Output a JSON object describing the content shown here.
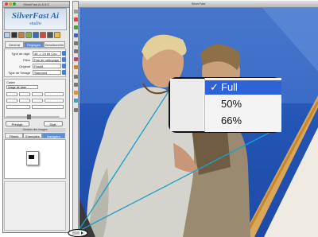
{
  "control_window": {
    "title": "SilverFast Ai 6.5.5",
    "logo": {
      "main": "SilverFast Ai",
      "sub": "studio"
    },
    "tabs": [
      {
        "label": "Général",
        "active": false
      },
      {
        "label": "Réglages",
        "active": true
      },
      {
        "label": "Densitomètre",
        "active": false
      }
    ],
    "fields": [
      {
        "label": "Type de digit.",
        "value": "48 -> 24 bit Cou"
      },
      {
        "label": "Filtre",
        "value": "Pas de nettoyage"
      },
      {
        "label": "Original",
        "value": "Positif"
      },
      {
        "label": "Type de l'image",
        "value": "Standard"
      }
    ],
    "frame_label": "Cadre",
    "frame_value": "Image de base",
    "buttons": [
      {
        "label": "Prédigit."
      },
      {
        "label": "Digit."
      }
    ],
    "section_header": "Gestion des images",
    "tabs2": [
      {
        "label": "Filmes",
        "active": false
      },
      {
        "label": "Exemples",
        "active": false
      },
      {
        "label": "Navigator",
        "active": true
      }
    ]
  },
  "image_window": {
    "title": "SilverFast"
  },
  "zoom_menu": {
    "items": [
      {
        "label": "Full",
        "checked": true,
        "selected": true
      },
      {
        "label": "50%",
        "checked": false,
        "selected": false
      },
      {
        "label": "66%",
        "checked": false,
        "selected": false
      }
    ],
    "check_glyph": "✓"
  },
  "colors": {
    "accent": "#2e62d9",
    "tab_active": "#5a8ed8",
    "logo_blue": "#3468a8",
    "callout_line": "#1aa0c8"
  }
}
